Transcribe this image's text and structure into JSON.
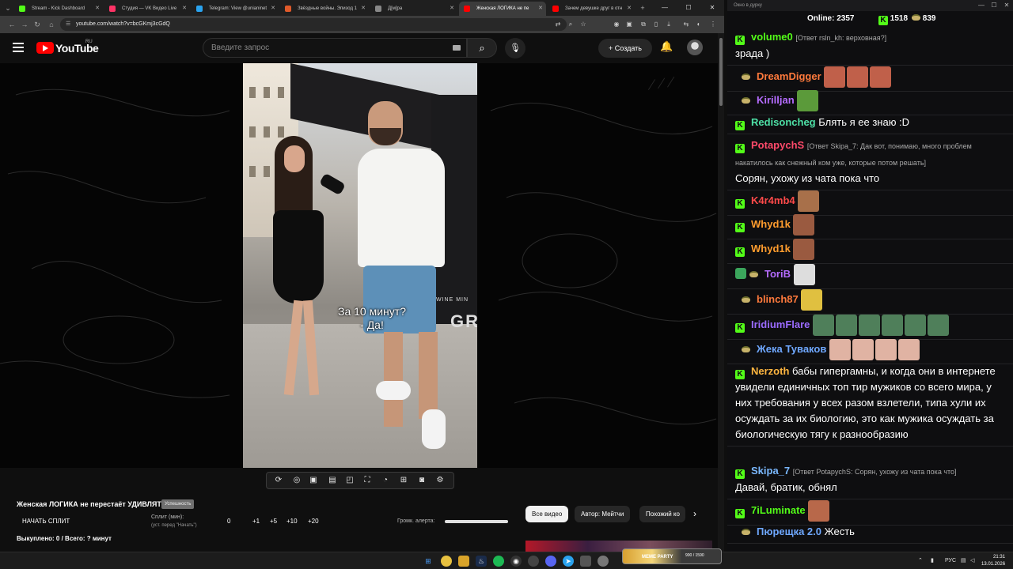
{
  "browser": {
    "tabs": [
      {
        "label": "Stream - Kick Dashboard",
        "color": "#53fc18"
      },
      {
        "label": "Студия — VK Видео Live",
        "color": "#ff3366"
      },
      {
        "label": "Telegram: View @unianinet",
        "color": "#2aa3ef"
      },
      {
        "label": "Звёздные войны. Эпизод 1",
        "color": "#e05a2a"
      },
      {
        "label": "Д[м]ра",
        "color": "#888888"
      },
      {
        "label": "Женская ЛОГИКА не пе",
        "color": "#ff0000"
      },
      {
        "label": "Зачем девушке друг в отн",
        "color": "#ff0000"
      }
    ],
    "url": "youtube.com/watch?v=bcGKmj3cGdQ"
  },
  "youtube": {
    "logo_text": "YouTube",
    "region": "RU",
    "search_placeholder": "Введите запрос",
    "create_label": "Создать",
    "subtitle_line1": "За 10 минут?",
    "subtitle_line2": "- Да!",
    "shop_text_small": "WINE MIN",
    "shop_text_big": "GRA",
    "video_title": "Женская ЛОГИКА не перестаёт УДИВЛЯТЬ",
    "video_badge": "Успешность",
    "split": {
      "start_label": "НАЧАТЬ СПЛИТ",
      "label": "Сплит (мин):",
      "sublabel": "(уст. перед \"Начать\")",
      "current": "0",
      "steps": [
        "+1",
        "+5",
        "+10",
        "+20"
      ],
      "alert_volume_label": "Громк. алерта:",
      "alert_volume_pct": 100,
      "done_text": "Выкуплено: 0 / Всего: ? минут"
    },
    "chips": [
      "Все видео",
      "Автор: Мейтчи",
      "Похожий ко"
    ]
  },
  "chat": {
    "window_title": "Окно в дурку",
    "online_label": "Online:",
    "online_count": "2357",
    "kick_count": "1518",
    "coin_count": "839",
    "messages": [
      {
        "user": "volume0",
        "color": "#53fc18",
        "badge": "kick",
        "reply": "[Ответ rsln_kh: верховная?]",
        "text": "зрада )"
      },
      {
        "user": "DreamDigger",
        "color": "#ff7a3c",
        "badge": "coin",
        "reply": "",
        "text": ""
      },
      {
        "user": "Kirilljan",
        "color": "#b56cff",
        "badge": "coin",
        "reply": "",
        "text": ""
      },
      {
        "user": "Redisoncheg",
        "color": "#4ee0a6",
        "badge": "kick",
        "reply": "",
        "text": "Блять я ее знаю :D"
      },
      {
        "user": "PotapychS",
        "color": "#ff4a6a",
        "badge": "kick",
        "reply": "[Ответ Skipa_7: Дак вот, понимаю, много проблем накатилось как снежный ком уже, которые потом решать]",
        "text": "Сорян, ухожу из чата пока что"
      },
      {
        "user": "K4r4mb4",
        "color": "#ff4a4a",
        "badge": "kick",
        "reply": "",
        "text": ""
      },
      {
        "user": "Whyd1k",
        "color": "#ff9d2e",
        "badge": "kick",
        "reply": "",
        "text": ""
      },
      {
        "user": "Whyd1k",
        "color": "#ff9d2e",
        "badge": "kick",
        "reply": "",
        "text": ""
      },
      {
        "user": "ToriB",
        "color": "#b56cff",
        "badge": "sub",
        "reply": "",
        "text": ""
      },
      {
        "user": "blinch87",
        "color": "#ff7a3c",
        "badge": "coin",
        "reply": "",
        "text": ""
      },
      {
        "user": "IridiumFlare",
        "color": "#9b6bff",
        "badge": "kick",
        "reply": "",
        "text": ""
      },
      {
        "user": "Жека Туваков",
        "color": "#6fa8ff",
        "badge": "coin",
        "reply": "",
        "text": ""
      },
      {
        "user": "Nerzoth",
        "color": "#ffb640",
        "badge": "kick",
        "reply": "",
        "text": "бабы гипергамны, и когда они в интернете увидели единичных топ тир мужиков со всего мира, у них требования у всех разом взлетели, типа хули их осуждать за их биологию, это как мужика осуждать за биологическую тягу к разнообразию"
      },
      {
        "user": "Skipa_7",
        "color": "#7ab8ff",
        "badge": "kick",
        "reply": "[Ответ PotapychS: Сорян, ухожу из чата пока что]",
        "text": "Давай, братик, обнял"
      },
      {
        "user": "7iLuminate",
        "color": "#53fc18",
        "badge": "kick",
        "reply": "",
        "text": ""
      },
      {
        "user": "Пюрещка 2.0",
        "color": "#6fa8ff",
        "badge": "coin",
        "reply": "",
        "text": "Жесть"
      }
    ]
  },
  "taskbar": {
    "lang": "РУС",
    "time": "21:31",
    "date": "13.01.2026",
    "meme_widget": "MEME PARTY",
    "meme_counter": "900 / 1590"
  }
}
